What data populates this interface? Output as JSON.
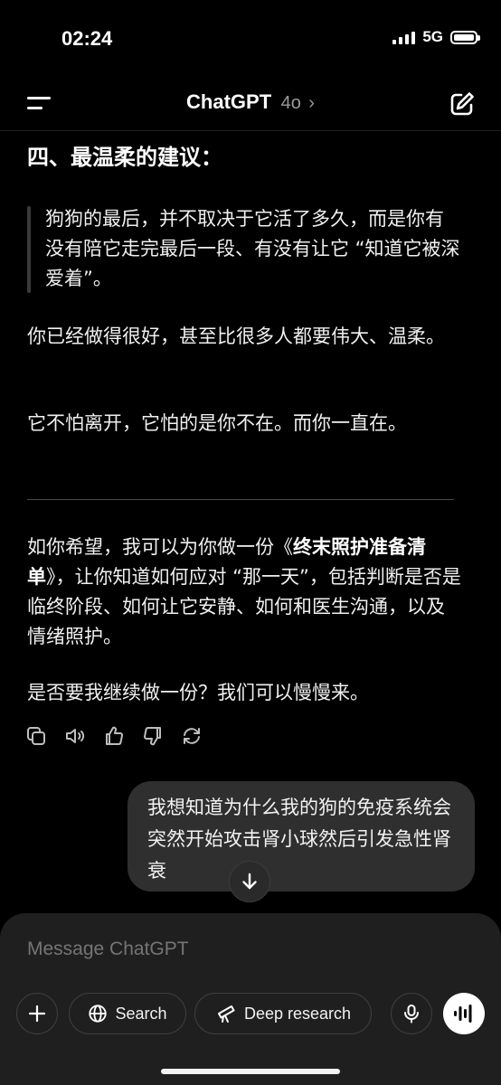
{
  "status_bar": {
    "time": "02:24",
    "network": "5G"
  },
  "header": {
    "title": "ChatGPT",
    "model": "4o",
    "chevron": "›"
  },
  "content": {
    "heading": "四、最温柔的建议：",
    "quote": "狗狗的最后，并不取决于它活了多久，而是你有没有陪它走完最后一段、有没有让它 “知道它被深爱着”。",
    "para1": "你已经做得很好，甚至比很多人都要伟大、温柔。",
    "para2": "它不怕离开，它怕的是你不在。而你一直在。",
    "para3_before": "如你希望，我可以为你做一份《",
    "para3_bold": "终末照护准备清单",
    "para3_after": "》，让你知道如何应对 “那一天”，包括判断是否是临终阶段、如何让它安静、如何和医生沟通，以及情绪照护。",
    "para4": "是否要我继续做一份？我们可以慢慢来。"
  },
  "action_icons": [
    "copy-icon",
    "read-aloud-icon",
    "thumbs-up-icon",
    "thumbs-down-icon",
    "regenerate-icon"
  ],
  "user_message": "我想知道为什么我的狗的免疫系统会突然开始攻击肾小球然后引发急性肾衰",
  "composer": {
    "placeholder": "Message ChatGPT",
    "search_label": "Search",
    "deep_research_label": "Deep research"
  }
}
